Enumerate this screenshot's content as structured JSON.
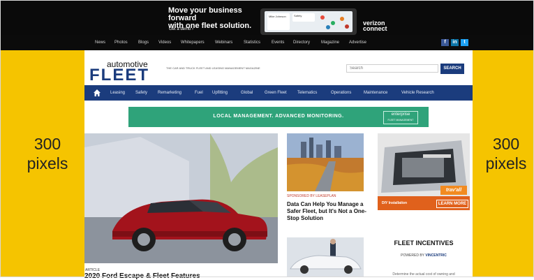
{
  "top_ad": {
    "headline_line1": "Move your business forward",
    "headline_line2": "with one fleet solution.",
    "cta": "Get a demo  ›",
    "brand_line1": "verizon",
    "brand_line2": "connect",
    "screen_name": "Mike Johnson",
    "screen_badge": "Safety"
  },
  "utility_nav": [
    "News",
    "Photos",
    "Blogs",
    "Videos",
    "Whitepapers",
    "Webinars",
    "Statistics",
    "Events",
    "Directory",
    "Magazine",
    "Advertise"
  ],
  "social": [
    "f",
    "in",
    "t"
  ],
  "gutter": {
    "left_value": "300",
    "left_unit": "pixels",
    "right_value": "300",
    "right_unit": "pixels"
  },
  "header": {
    "logo_top": "automotive",
    "logo_main": "FLEET",
    "tagline": "THE CAR AND TRUCK FLEET AND LEASING MANAGEMENT MAGAZINE",
    "search_placeholder": "Search",
    "search_button": "SEARCH"
  },
  "main_nav": [
    "Leasing",
    "Safety",
    "Remarketing",
    "Fuel",
    "Upfitting",
    "Global",
    "Green Fleet",
    "Telematics",
    "Operations",
    "Maintenance",
    "Vehicle Research"
  ],
  "ad_strip": {
    "text": "LOCAL MANAGEMENT. ADVANCED MONITORING.",
    "logo_line1": "enterprise",
    "logo_line2": "FLEET MANAGEMENT"
  },
  "hero": {
    "kicker": "ARTICLE",
    "title": "2020 Ford Escape & Fleet Features"
  },
  "mid_story": {
    "sponsored": "SPONSORED BY LEASEPLAN",
    "title": "Data Can Help You Manage a Safer Fleet, but It's Not a One-Stop Solution"
  },
  "right_ad": {
    "diy": "DIY Installation",
    "learn_more": "LEARN MORE",
    "brand": "trav'all"
  },
  "incentives": {
    "title": "FLEET INCENTIVES",
    "powered_by": "POWERED BY",
    "powered_brand": "VINCENTRIC",
    "text": "Determine the actual cost of owning and"
  },
  "colors": {
    "gutter_yellow": "#f5c400",
    "brand_navy": "#1b3c7d",
    "ad_green": "#2fa37a",
    "travall_orange": "#e0611c"
  }
}
